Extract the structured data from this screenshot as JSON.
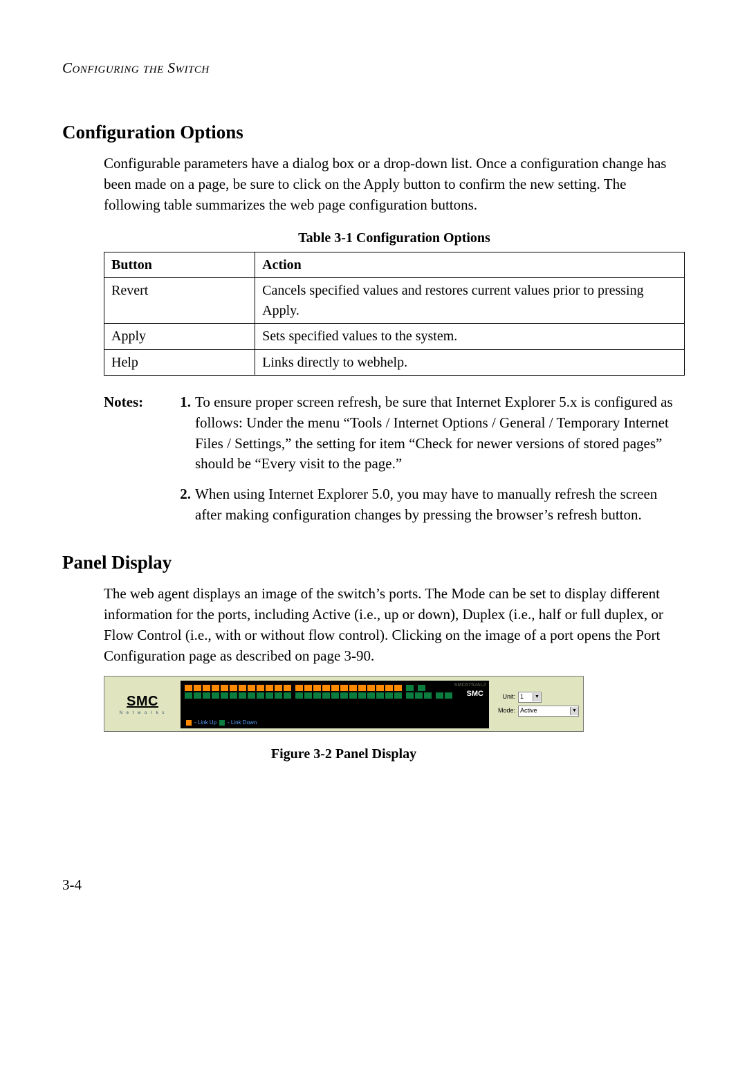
{
  "running_header": "Configuring the Switch",
  "section1": {
    "title": "Configuration Options",
    "intro": "Configurable parameters have a dialog box or a drop-down list. Once a configuration change has been made on a page, be sure to click on the Apply button to confirm the new setting. The following table summarizes the web page configuration buttons.",
    "table_caption": "Table 3-1  Configuration Options",
    "table_headers": {
      "button": "Button",
      "action": "Action"
    },
    "table_rows": [
      {
        "button": "Revert",
        "action": "Cancels specified values and restores current values prior to pressing Apply."
      },
      {
        "button": "Apply",
        "action": "Sets specified values to the system."
      },
      {
        "button": "Help",
        "action": "Links directly to webhelp."
      }
    ],
    "notes_label": "Notes:",
    "notes": [
      "To ensure proper screen refresh, be sure that Internet Explorer 5.x is configured as follows: Under the menu “Tools / Internet Options / General / Temporary Internet Files / Settings,” the setting for item “Check for newer versions of stored pages” should be “Every visit to the page.”",
      "When using Internet Explorer 5.0, you may have to manually refresh the screen after making configuration changes by pressing the browser’s refresh button."
    ]
  },
  "section2": {
    "title": "Panel Display",
    "intro": "The web agent displays an image of the switch’s ports. The Mode can be set to display different information for the ports, including Active (i.e., up or down), Duplex (i.e., half or full duplex, or Flow Control (i.e., with or without flow control). Clicking on the image of a port opens the Port Configuration page as described on page 3-90.",
    "figure_caption": "Figure 3-2  Panel Display"
  },
  "panel": {
    "brand": "SMC",
    "brand_sub": "N e t w o r k s",
    "model": "SMC6752AL2",
    "legend_up": "- Link Up",
    "legend_down": "- Link Down",
    "unit_label": "Unit:",
    "unit_value": "1",
    "mode_label": "Mode:",
    "mode_value": "Active"
  },
  "page_number": "3-4"
}
